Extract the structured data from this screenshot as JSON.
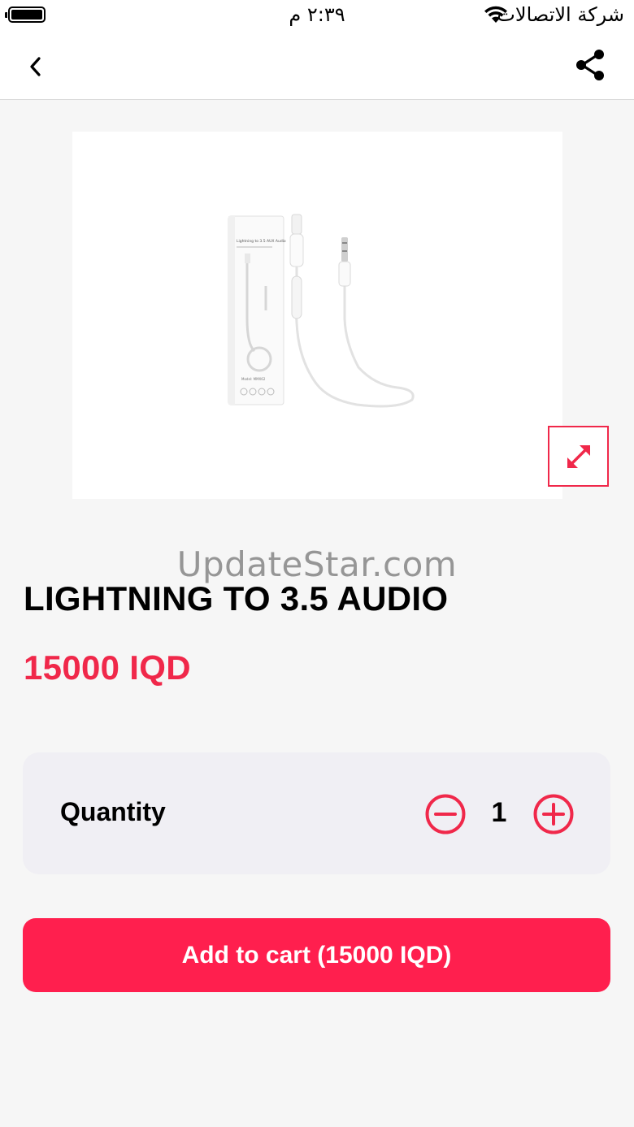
{
  "status_bar": {
    "time": "٢:٣٩ م",
    "carrier": "شركة الاتصالات",
    "wifi_icon": "wifi-icon",
    "battery_icon": "battery-icon"
  },
  "nav": {
    "back_icon": "chevron-left-icon",
    "share_icon": "share-icon"
  },
  "product": {
    "image_alt": "product-photo",
    "box_text": "Lightning to 3.5 AUX Audio",
    "expand_icon": "expand-icon",
    "title": "LIGHTNING TO 3.5 AUDIO",
    "price": "15000 IQD"
  },
  "watermark": "UpdateStar.com",
  "quantity": {
    "label": "Quantity",
    "value": "1",
    "minus_icon": "minus-circle-icon",
    "plus_icon": "plus-circle-icon"
  },
  "cart": {
    "add_label": "Add to cart (15000 IQD)"
  },
  "colors": {
    "accent": "#f0284a",
    "button": "#ff1f4e",
    "card_bg": "#f0eff4",
    "page_bg": "#f6f6f6"
  }
}
